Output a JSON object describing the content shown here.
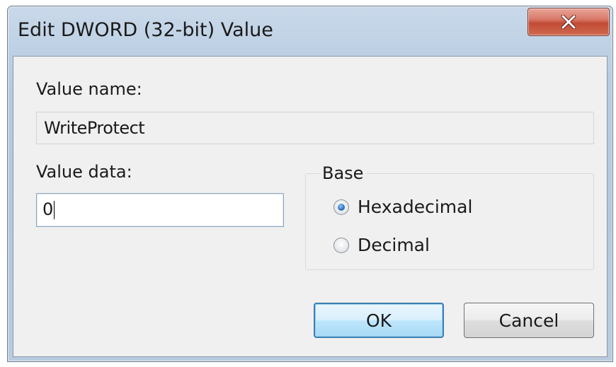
{
  "window": {
    "title": "Edit DWORD (32-bit) Value",
    "close_icon": "close-x-icon"
  },
  "value_name": {
    "label": "Value name:",
    "value": "WriteProtect"
  },
  "value_data": {
    "label": "Value data:",
    "value": "0"
  },
  "base": {
    "title": "Base",
    "options": [
      {
        "label": "Hexadecimal",
        "checked": true
      },
      {
        "label": "Decimal",
        "checked": false
      }
    ]
  },
  "buttons": {
    "ok": "OK",
    "cancel": "Cancel"
  },
  "colors": {
    "title_bar": "#b9cbde",
    "close_button": "#c24b36",
    "default_button_border": "#3c7fb1"
  }
}
